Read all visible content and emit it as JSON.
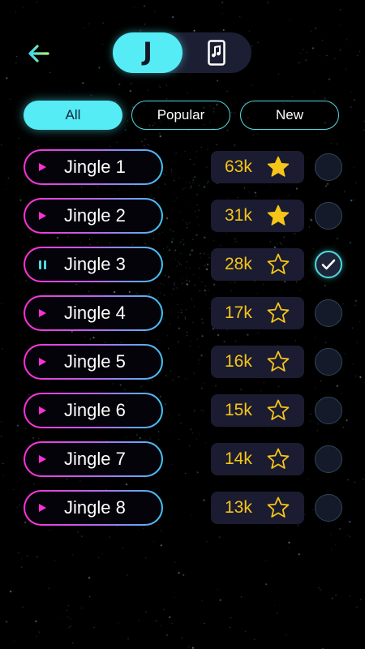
{
  "colors": {
    "accent": "#55ecf5",
    "pink": "#ff2fd5",
    "gold": "#f5c518",
    "background": "#000000",
    "card": "#1b1c31"
  },
  "header": {
    "back_icon": "arrow-left-icon",
    "mode_toggle": {
      "jingle_label": "J",
      "ringtone_icon": "phone-music-icon",
      "active": "jingle"
    }
  },
  "filters": {
    "tabs": [
      {
        "label": "All",
        "active": true
      },
      {
        "label": "Popular",
        "active": false
      },
      {
        "label": "New",
        "active": false
      }
    ]
  },
  "jingles": [
    {
      "name": "Jingle 1",
      "count": "63k",
      "favorite": true,
      "playing": false,
      "selected": false
    },
    {
      "name": "Jingle 2",
      "count": "31k",
      "favorite": true,
      "playing": false,
      "selected": false
    },
    {
      "name": "Jingle 3",
      "count": "28k",
      "favorite": false,
      "playing": true,
      "selected": true
    },
    {
      "name": "Jingle 4",
      "count": "17k",
      "favorite": false,
      "playing": false,
      "selected": false
    },
    {
      "name": "Jingle 5",
      "count": "16k",
      "favorite": false,
      "playing": false,
      "selected": false
    },
    {
      "name": "Jingle 6",
      "count": "15k",
      "favorite": false,
      "playing": false,
      "selected": false
    },
    {
      "name": "Jingle 7",
      "count": "14k",
      "favorite": false,
      "playing": false,
      "selected": false
    },
    {
      "name": "Jingle 8",
      "count": "13k",
      "favorite": false,
      "playing": false,
      "selected": false
    }
  ]
}
